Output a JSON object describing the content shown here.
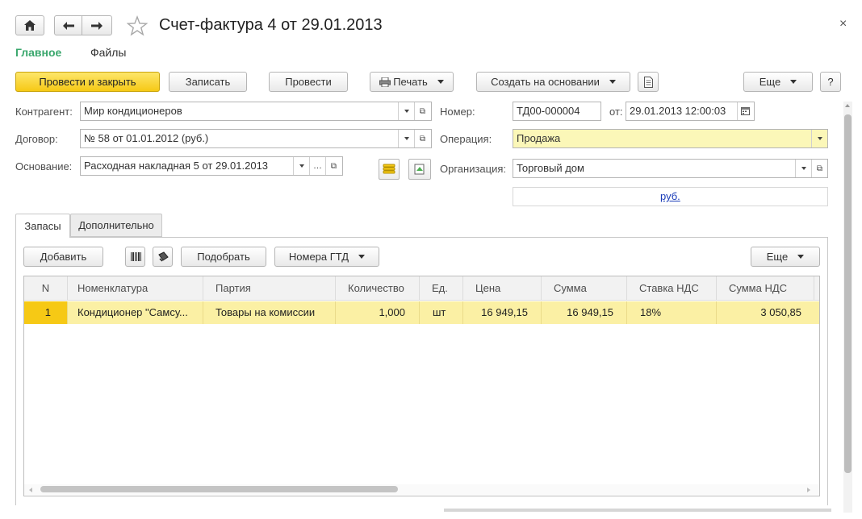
{
  "window": {
    "title": "Счет-фактура 4 от 29.01.2013",
    "close": "×"
  },
  "nav": {
    "main": "Главное",
    "files": "Файлы"
  },
  "toolbar": {
    "post_close": "Провести и закрыть",
    "save": "Записать",
    "post": "Провести",
    "print": "Печать",
    "create_based": "Создать на основании",
    "more": "Еще",
    "help": "?"
  },
  "form": {
    "counterparty_label": "Контрагент:",
    "counterparty_value": "Мир кондиционеров",
    "contract_label": "Договор:",
    "contract_value": "№ 58 от 01.01.2012 (руб.)",
    "basis_label": "Основание:",
    "basis_value": "Расходная накладная 5 от 29.01.2013",
    "number_label": "Номер:",
    "number_value": "ТД00-000004",
    "date_label": "от:",
    "date_value": "29.01.2013 12:00:03",
    "operation_label": "Операция:",
    "operation_value": "Продажа",
    "org_label": "Организация:",
    "org_value": "Торговый дом",
    "currency_link": "руб."
  },
  "tabs": {
    "active": "Запасы",
    "other": "Дополнительно"
  },
  "table_toolbar": {
    "add": "Добавить",
    "pick": "Подобрать",
    "gtd": "Номера ГТД",
    "more": "Еще"
  },
  "table": {
    "headers": [
      "N",
      "Номенклатура",
      "Партия",
      "Количество",
      "Ед.",
      "Цена",
      "Сумма",
      "Ставка НДС",
      "Сумма НДС"
    ],
    "rows": [
      [
        "1",
        "Кондиционер \"Самсу...",
        "Товары на комиссии",
        "1,000",
        "шт",
        "16 949,15",
        "16 949,15",
        "18%",
        "3 050,85"
      ]
    ]
  },
  "colors": {
    "accent_yellow": "#f6c915",
    "selected_row": "#fbf0a4",
    "nav_active": "#3aa76d"
  }
}
